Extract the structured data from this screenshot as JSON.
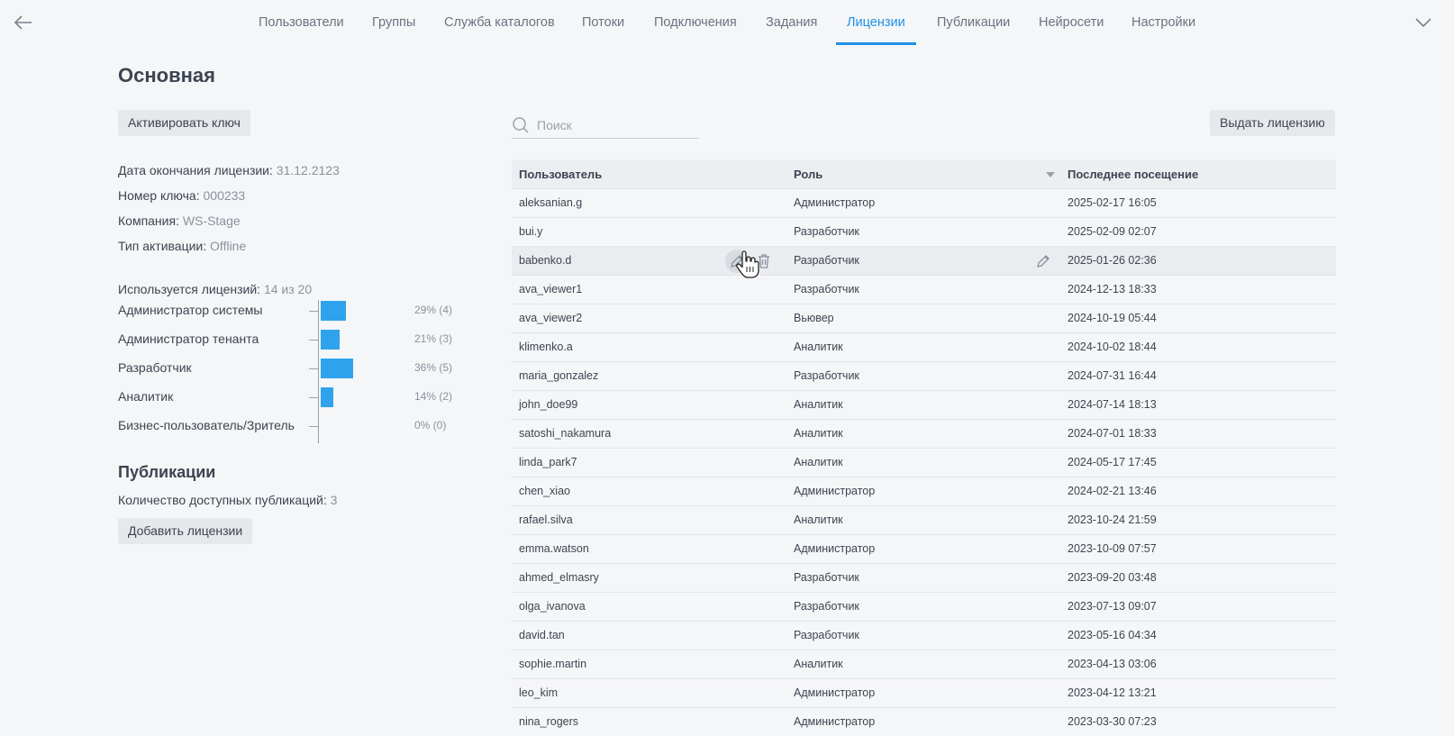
{
  "nav": {
    "items": [
      "Пользователи",
      "Группы",
      "Служба каталогов",
      "Потоки",
      "Подключения",
      "Задания",
      "Лицензии",
      "Публикации",
      "Нейросети",
      "Настройки"
    ],
    "active": "Лицензии",
    "accent": "#1e90e6"
  },
  "page": {
    "title": "Основная",
    "activate_button": "Активировать ключ",
    "info": [
      {
        "label": "Дата окончания лицензии:",
        "value": "31.12.2123"
      },
      {
        "label": "Номер ключа:",
        "value": "000233"
      },
      {
        "label": "Компания:",
        "value": "WS-Stage"
      },
      {
        "label": "Тип активации:",
        "value": "Offline"
      }
    ],
    "usage": {
      "label": "Используется лицензий:",
      "value": "14 из 20"
    }
  },
  "chart_data": {
    "type": "bar",
    "orientation": "horizontal",
    "categories": [
      "Администратор системы",
      "Администратор тенанта",
      "Разработчик",
      "Аналитик",
      "Бизнес-пользователь/Зритель"
    ],
    "values": [
      4,
      3,
      5,
      2,
      0
    ],
    "labels": [
      "29% (4)",
      "21% (3)",
      "36% (5)",
      "14% (2)",
      "0% (0)"
    ],
    "bar_color": "#2ea3ec"
  },
  "publications": {
    "title": "Публикации",
    "label": "Количество доступных публикаций:",
    "value": "3",
    "add_button": "Добавить лицензии"
  },
  "search": {
    "placeholder": "Поиск"
  },
  "issue_button": "Выдать лицензию",
  "table": {
    "headers": [
      "Пользователь",
      "Роль",
      "Последнее посещение"
    ],
    "rows": [
      {
        "user": "aleksanian.g",
        "role": "Администратор",
        "visit": "2025-02-17 16:05"
      },
      {
        "user": "bui.y",
        "role": "Разработчик",
        "visit": "2025-02-09 02:07"
      },
      {
        "user": "babenko.d",
        "role": "Разработчик",
        "visit": "2025-01-26 02:36"
      },
      {
        "user": "ava_viewer1",
        "role": "Разработчик",
        "visit": "2024-12-13 18:33"
      },
      {
        "user": "ava_viewer2",
        "role": "Вьювер",
        "visit": "2024-10-19 05:44"
      },
      {
        "user": "klimenko.a",
        "role": "Аналитик",
        "visit": "2024-10-02 18:44"
      },
      {
        "user": "maria_gonzalez",
        "role": "Разработчик",
        "visit": "2024-07-31 16:44"
      },
      {
        "user": "john_doe99",
        "role": "Аналитик",
        "visit": "2024-07-14 18:13"
      },
      {
        "user": "satoshi_nakamura",
        "role": "Аналитик",
        "visit": "2024-07-01 18:33"
      },
      {
        "user": "linda_park7",
        "role": "Аналитик",
        "visit": "2024-05-17 17:45"
      },
      {
        "user": "chen_xiao",
        "role": "Администратор",
        "visit": "2024-02-21 13:46"
      },
      {
        "user": "rafael.silva",
        "role": "Аналитик",
        "visit": "2023-10-24 21:59"
      },
      {
        "user": "emma.watson",
        "role": "Администратор",
        "visit": "2023-10-09 07:57"
      },
      {
        "user": "ahmed_elmasry",
        "role": "Разработчик",
        "visit": "2023-09-20 03:48"
      },
      {
        "user": "olga_ivanova",
        "role": "Разработчик",
        "visit": "2023-07-13 09:07"
      },
      {
        "user": "david.tan",
        "role": "Разработчик",
        "visit": "2023-05-16 04:34"
      },
      {
        "user": "sophie.martin",
        "role": "Аналитик",
        "visit": "2023-04-13 03:06"
      },
      {
        "user": "leo_kim",
        "role": "Администратор",
        "visit": "2023-04-12 13:21"
      },
      {
        "user": "nina_rogers",
        "role": "Администратор",
        "visit": "2023-03-30 07:23"
      }
    ],
    "hover_row": "babenko.d"
  }
}
